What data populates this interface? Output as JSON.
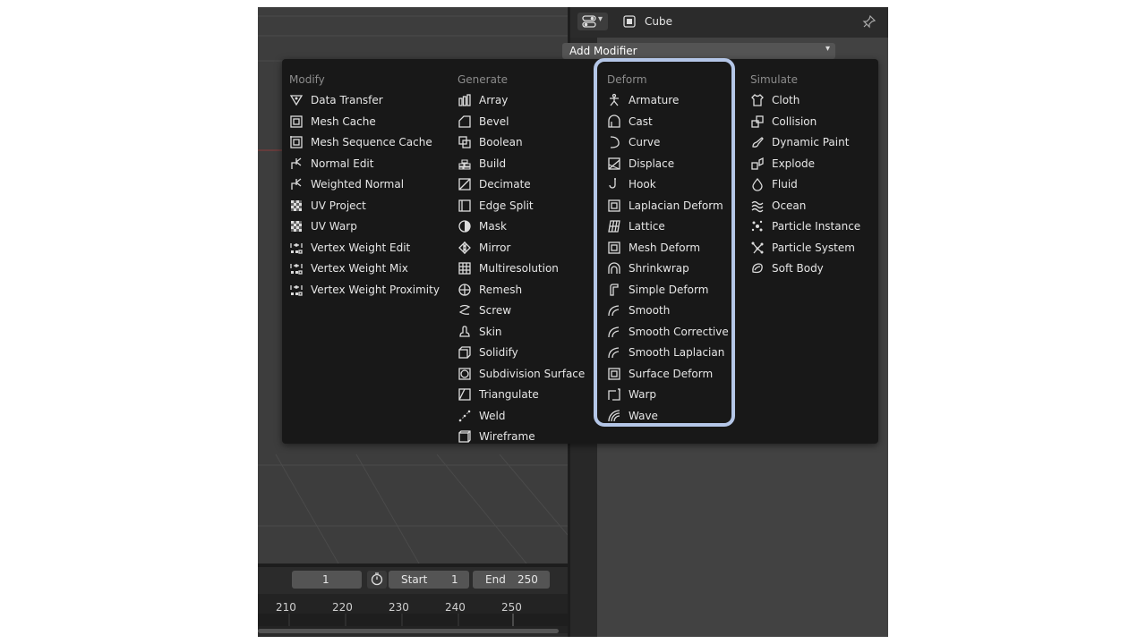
{
  "header": {
    "object_name": "Cube"
  },
  "add_modifier": {
    "label": "Add Modifier"
  },
  "timeline": {
    "current_frame": "1",
    "start_label": "Start",
    "start_value": "1",
    "end_label": "End",
    "end_value": "250",
    "ticks": [
      "210",
      "220",
      "230",
      "240",
      "250"
    ]
  },
  "menu": {
    "columns": [
      {
        "title": "Modify",
        "items": [
          {
            "label": "Data Transfer",
            "icon": "data-transfer-icon"
          },
          {
            "label": "Mesh Cache",
            "icon": "mesh-cache-icon"
          },
          {
            "label": "Mesh Sequence Cache",
            "icon": "mesh-sequence-cache-icon"
          },
          {
            "label": "Normal Edit",
            "icon": "normal-edit-icon"
          },
          {
            "label": "Weighted Normal",
            "icon": "weighted-normal-icon"
          },
          {
            "label": "UV Project",
            "icon": "uv-project-icon"
          },
          {
            "label": "UV Warp",
            "icon": "uv-warp-icon"
          },
          {
            "label": "Vertex Weight Edit",
            "icon": "vertex-weight-icon"
          },
          {
            "label": "Vertex Weight Mix",
            "icon": "vertex-weight-icon"
          },
          {
            "label": "Vertex Weight Proximity",
            "icon": "vertex-weight-icon"
          }
        ]
      },
      {
        "title": "Generate",
        "items": [
          {
            "label": "Array",
            "icon": "array-icon"
          },
          {
            "label": "Bevel",
            "icon": "bevel-icon"
          },
          {
            "label": "Boolean",
            "icon": "boolean-icon"
          },
          {
            "label": "Build",
            "icon": "build-icon"
          },
          {
            "label": "Decimate",
            "icon": "decimate-icon"
          },
          {
            "label": "Edge Split",
            "icon": "edge-split-icon"
          },
          {
            "label": "Mask",
            "icon": "mask-icon"
          },
          {
            "label": "Mirror",
            "icon": "mirror-icon"
          },
          {
            "label": "Multiresolution",
            "icon": "multiresolution-icon"
          },
          {
            "label": "Remesh",
            "icon": "remesh-icon"
          },
          {
            "label": "Screw",
            "icon": "screw-icon"
          },
          {
            "label": "Skin",
            "icon": "skin-icon"
          },
          {
            "label": "Solidify",
            "icon": "solidify-icon"
          },
          {
            "label": "Subdivision Surface",
            "icon": "subdivision-surface-icon"
          },
          {
            "label": "Triangulate",
            "icon": "triangulate-icon"
          },
          {
            "label": "Weld",
            "icon": "weld-icon"
          },
          {
            "label": "Wireframe",
            "icon": "wireframe-icon"
          }
        ]
      },
      {
        "title": "Deform",
        "items": [
          {
            "label": "Armature",
            "icon": "armature-icon"
          },
          {
            "label": "Cast",
            "icon": "cast-icon"
          },
          {
            "label": "Curve",
            "icon": "curve-icon"
          },
          {
            "label": "Displace",
            "icon": "displace-icon"
          },
          {
            "label": "Hook",
            "icon": "hook-icon"
          },
          {
            "label": "Laplacian Deform",
            "icon": "laplacian-deform-icon"
          },
          {
            "label": "Lattice",
            "icon": "lattice-icon"
          },
          {
            "label": "Mesh Deform",
            "icon": "mesh-deform-icon"
          },
          {
            "label": "Shrinkwrap",
            "icon": "shrinkwrap-icon"
          },
          {
            "label": "Simple Deform",
            "icon": "simple-deform-icon"
          },
          {
            "label": "Smooth",
            "icon": "smooth-icon"
          },
          {
            "label": "Smooth Corrective",
            "icon": "smooth-icon"
          },
          {
            "label": "Smooth Laplacian",
            "icon": "smooth-icon"
          },
          {
            "label": "Surface Deform",
            "icon": "surface-deform-icon"
          },
          {
            "label": "Warp",
            "icon": "warp-icon"
          },
          {
            "label": "Wave",
            "icon": "wave-icon"
          }
        ]
      },
      {
        "title": "Simulate",
        "items": [
          {
            "label": "Cloth",
            "icon": "cloth-icon"
          },
          {
            "label": "Collision",
            "icon": "collision-icon"
          },
          {
            "label": "Dynamic Paint",
            "icon": "dynamic-paint-icon"
          },
          {
            "label": "Explode",
            "icon": "explode-icon"
          },
          {
            "label": "Fluid",
            "icon": "fluid-icon"
          },
          {
            "label": "Ocean",
            "icon": "ocean-icon"
          },
          {
            "label": "Particle Instance",
            "icon": "particle-instance-icon"
          },
          {
            "label": "Particle System",
            "icon": "particle-system-icon"
          },
          {
            "label": "Soft Body",
            "icon": "soft-body-icon"
          }
        ]
      }
    ]
  },
  "colors": {
    "highlight": "#b4c6e7",
    "menu_bg": "#181818",
    "text": "#e6e6e6",
    "header_text": "#8c8c8c"
  }
}
